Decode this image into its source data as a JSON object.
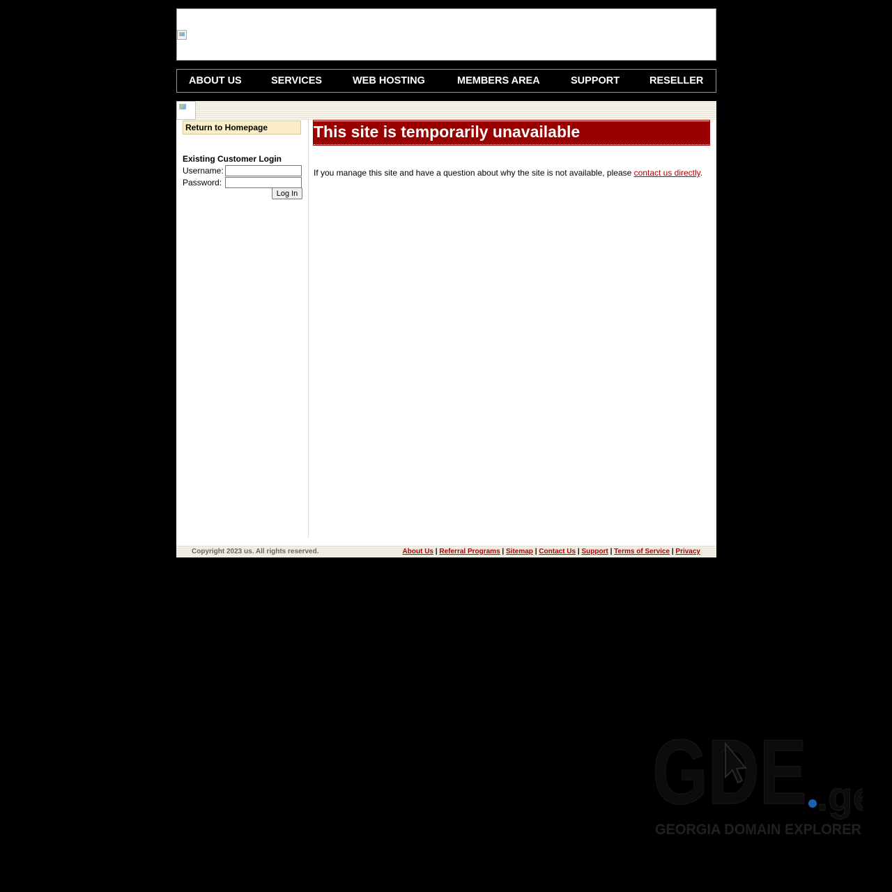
{
  "nav": {
    "items": [
      {
        "label": "ABOUT US"
      },
      {
        "label": "SERVICES"
      },
      {
        "label": "WEB HOSTING"
      },
      {
        "label": "MEMBERS AREA"
      },
      {
        "label": "SUPPORT"
      },
      {
        "label": "RESELLER"
      }
    ]
  },
  "sidebar": {
    "return_label": "Return to Homepage",
    "login_title": "Existing Customer Login",
    "username_label": "Username:",
    "password_label": "Password:",
    "username_value": "",
    "password_value": "",
    "login_button": "Log In"
  },
  "main": {
    "heading": "This site is temporarily unavailable",
    "message": "If you manage this site and have a question about why the site is not available, please ",
    "contact_link": "contact us directly",
    "message_end": "."
  },
  "footer": {
    "copyright": "Copyright 2023 us. All rights reserved.",
    "links": [
      "About Us",
      "Referral Programs",
      "Sitemap",
      "Contact Us",
      "Support",
      "Terms of Service",
      "Privacy"
    ],
    "separator": "|"
  },
  "watermark": {
    "logo_text": "GDE",
    "logo_suffix": ".ge",
    "tagline": "GEORGIA DOMAIN EXPLORER"
  },
  "colors": {
    "page_background": "#000000",
    "heading_background": "#990000",
    "link_color": "#b30000",
    "sidebar_highlight": "#fcefc8",
    "watermark_dot": "#1d5fb8"
  }
}
